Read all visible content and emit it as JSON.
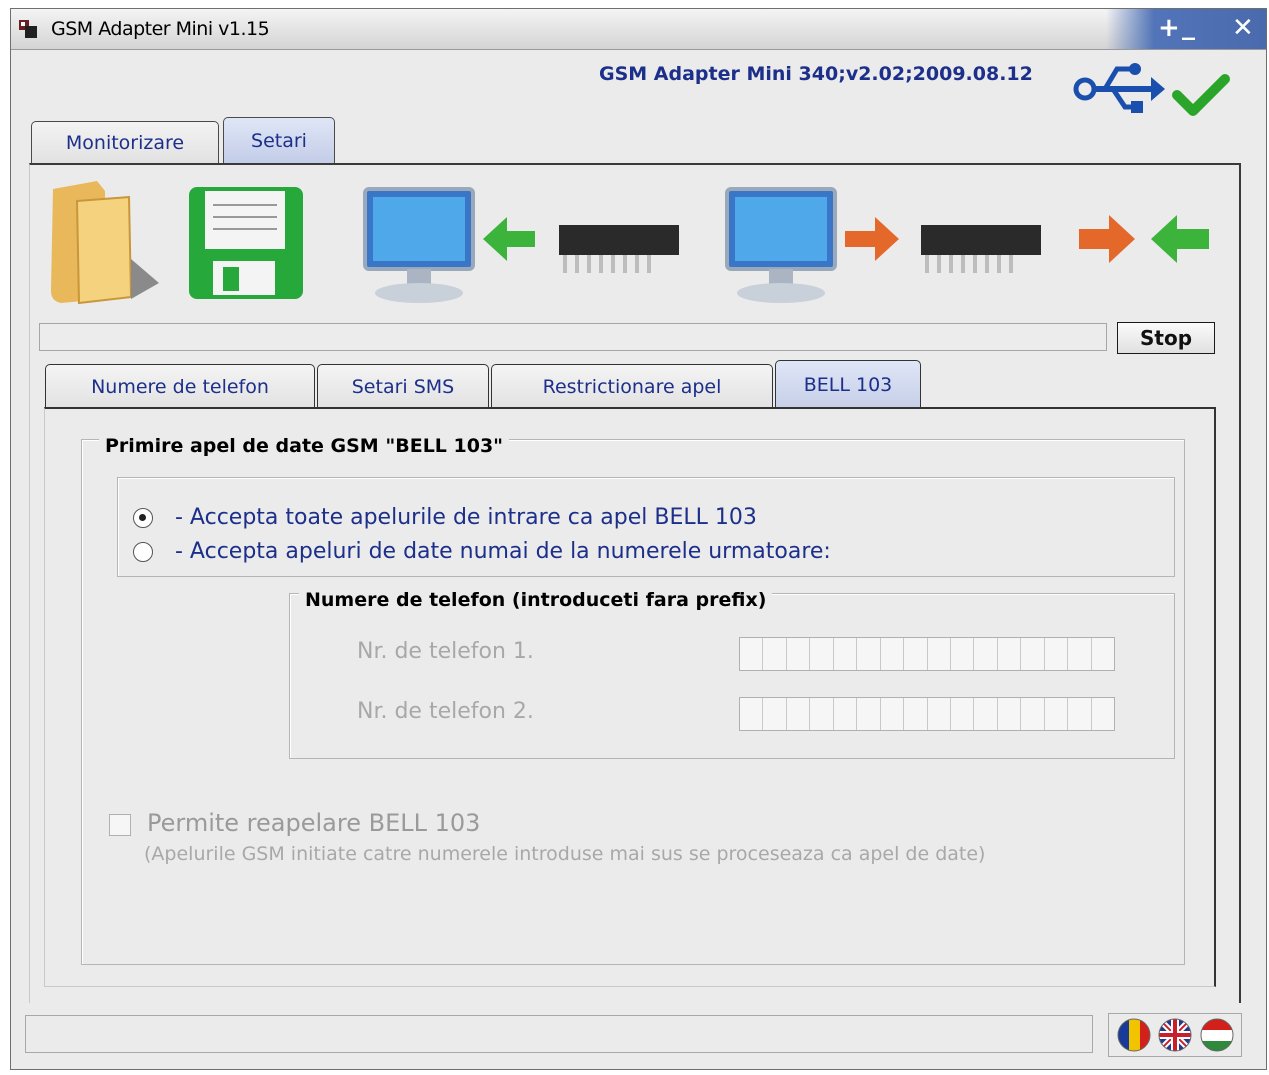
{
  "window": {
    "title": "GSM Adapter Mini v1.15",
    "device_info": "GSM Adapter Mini 340;v2.02;2009.08.12"
  },
  "main_tabs": [
    {
      "label": "Monitorizare",
      "active": false
    },
    {
      "label": "Setari",
      "active": true
    }
  ],
  "toolbar": {
    "icons": [
      "folder-open-icon",
      "save-floppy-icon",
      "read-from-device-icon",
      "write-to-device-icon",
      "transfer-arrows-icon"
    ],
    "stop_label": "Stop"
  },
  "sub_tabs": [
    {
      "label": "Numere de telefon",
      "active": false
    },
    {
      "label": "Setari SMS",
      "active": false
    },
    {
      "label": "Restrictionare apel",
      "active": false
    },
    {
      "label": "BELL 103",
      "active": true
    }
  ],
  "bell103": {
    "group_title": "Primire apel de date GSM \"BELL 103\"",
    "option_all": "- Accepta toate apelurile de intrare ca apel BELL 103",
    "option_numbers": "- Accepta apeluri de date numai de la numerele urmatoare:",
    "selected_option": "all",
    "phones_group_title": "Numere de telefon (introduceti fara prefix)",
    "phone1_label": "Nr. de telefon 1.",
    "phone1_value": "",
    "phone2_label": "Nr. de telefon 2.",
    "phone2_value": "",
    "redial_label": "Permite reapelare BELL 103",
    "redial_checked": false,
    "redial_note": "(Apelurile GSM initiate catre numerele introduse mai sus se proceseaza ca apel de date)"
  },
  "status": {
    "text": "",
    "languages": [
      "romanian-flag-icon",
      "english-flag-icon",
      "hungarian-flag-icon"
    ]
  },
  "colors": {
    "accent_text": "#1c2f8a",
    "active_tab": "#c7cfe8",
    "background": "#ebebeb",
    "disabled_text": "#a8a8a8"
  }
}
